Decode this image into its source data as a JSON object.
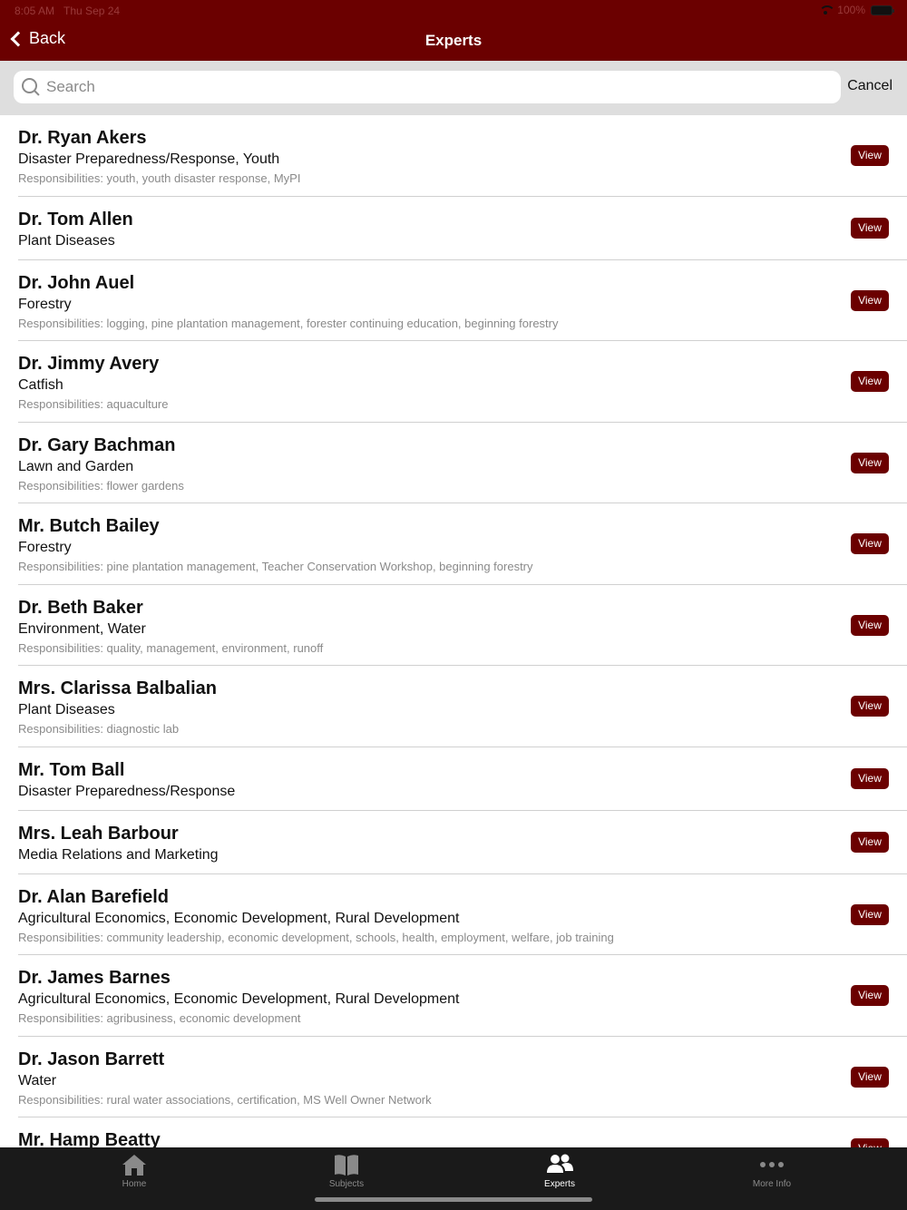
{
  "status": {
    "time": "8:05 AM",
    "date": "Thu Sep 24",
    "battery": "100%"
  },
  "nav": {
    "back_label": "Back",
    "title": "Experts"
  },
  "search": {
    "placeholder": "Search",
    "value": "",
    "cancel_label": "Cancel"
  },
  "view_label": "View",
  "experts": [
    {
      "name": "Dr. Ryan Akers",
      "subject": "Disaster Preparedness/Response, Youth",
      "responsibilities": "Responsibilities: youth, youth disaster response, MyPI"
    },
    {
      "name": "Dr. Tom Allen",
      "subject": "Plant Diseases",
      "responsibilities": ""
    },
    {
      "name": "Dr. John Auel",
      "subject": "Forestry",
      "responsibilities": "Responsibilities: logging, pine plantation management, forester continuing education, beginning forestry"
    },
    {
      "name": "Dr. Jimmy Avery",
      "subject": "Catfish",
      "responsibilities": "Responsibilities: aquaculture"
    },
    {
      "name": "Dr. Gary Bachman",
      "subject": "Lawn and Garden",
      "responsibilities": "Responsibilities: flower gardens"
    },
    {
      "name": "Mr. Butch Bailey",
      "subject": "Forestry",
      "responsibilities": "Responsibilities: pine plantation management, Teacher Conservation Workshop, beginning forestry"
    },
    {
      "name": "Dr. Beth Baker",
      "subject": "Environment, Water",
      "responsibilities": "Responsibilities: quality, management, environment, runoff"
    },
    {
      "name": "Mrs. Clarissa Balbalian",
      "subject": "Plant Diseases",
      "responsibilities": "Responsibilities: diagnostic lab"
    },
    {
      "name": "Mr. Tom Ball",
      "subject": "Disaster Preparedness/Response",
      "responsibilities": ""
    },
    {
      "name": "Mrs. Leah Barbour",
      "subject": "Media Relations and Marketing",
      "responsibilities": ""
    },
    {
      "name": "Dr. Alan Barefield",
      "subject": "Agricultural Economics, Economic Development, Rural Development",
      "responsibilities": "Responsibilities: community leadership, economic development, schools, health, employment, welfare, job training"
    },
    {
      "name": "Dr. James Barnes",
      "subject": "Agricultural Economics, Economic Development, Rural Development",
      "responsibilities": "Responsibilities: agribusiness, economic development"
    },
    {
      "name": "Dr. Jason Barrett",
      "subject": "Water",
      "responsibilities": "Responsibilities: rural water associations, certification, MS Well Owner Network"
    },
    {
      "name": "Mr. Hamp Beatty",
      "subject": "",
      "responsibilities": ""
    }
  ],
  "tabs": [
    {
      "label": "Home",
      "icon": "home-icon",
      "active": false
    },
    {
      "label": "Subjects",
      "icon": "book-icon",
      "active": false
    },
    {
      "label": "Experts",
      "icon": "people-icon",
      "active": true
    },
    {
      "label": "More Info",
      "icon": "more-icon",
      "active": false
    }
  ],
  "colors": {
    "brand": "#6b0000",
    "tab_bar": "#1a1a1a"
  }
}
